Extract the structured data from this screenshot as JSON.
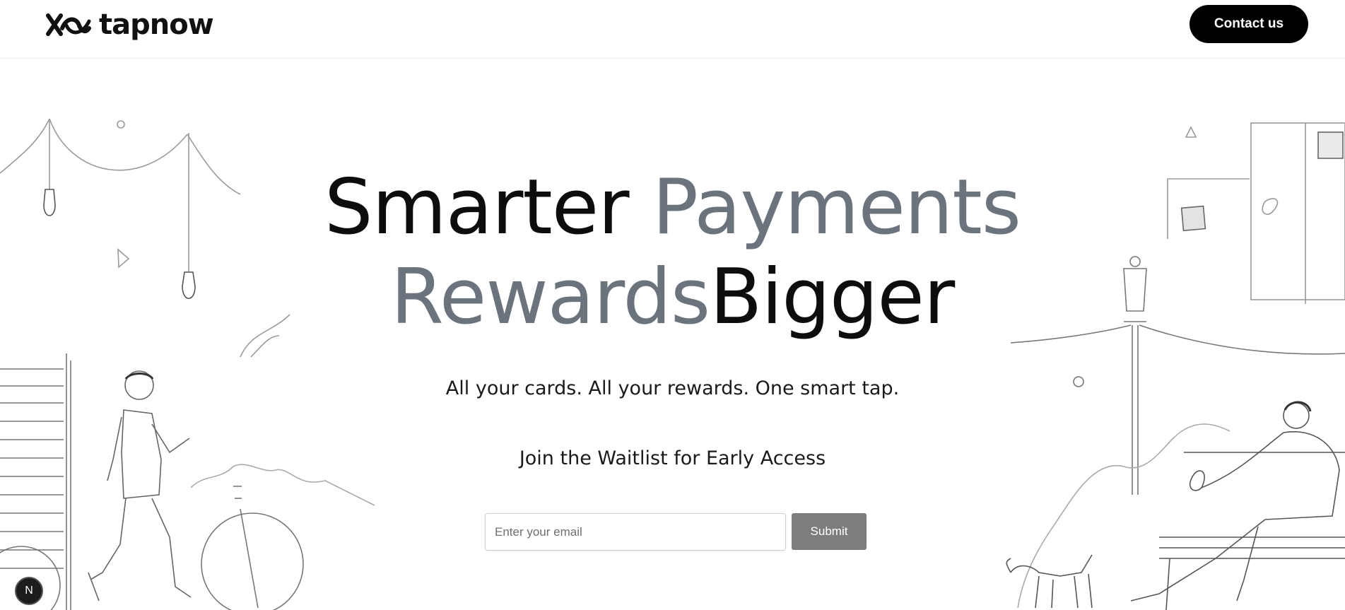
{
  "brand": {
    "name": "tapnow",
    "logo_icon": "xo-mark-icon"
  },
  "header": {
    "contact_label": "Contact us"
  },
  "hero": {
    "line1_word1": "Smarter",
    "line1_word2": "Payments",
    "line2_word1": "Rewards",
    "line2_word2": "Bigger",
    "tagline": "All your cards. All your rewards. One smart tap.",
    "waitlist_heading": "Join the Waitlist for Early Access"
  },
  "form": {
    "email_placeholder": "Enter your email",
    "email_value": "",
    "submit_label": "Submit"
  },
  "badge": {
    "label": "N"
  },
  "colors": {
    "accent_dark": "#0d0d0d",
    "accent_grey": "#6b737c",
    "button_bg": "#000000",
    "submit_bg": "#7d7d7d"
  }
}
